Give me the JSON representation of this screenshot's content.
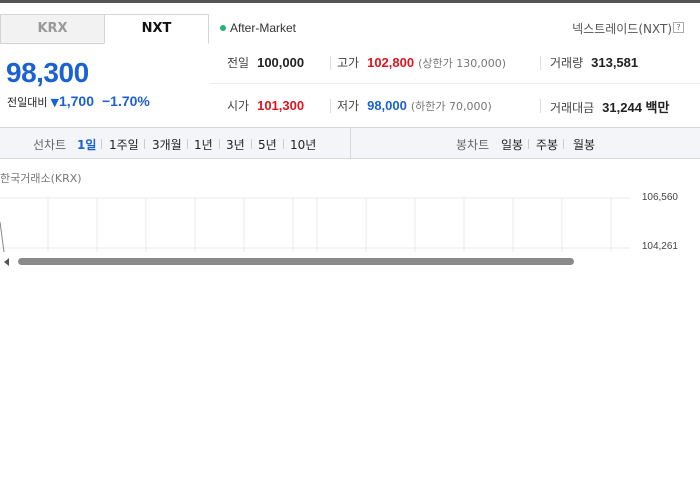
{
  "tabs": [
    {
      "label": "KRX",
      "active": false
    },
    {
      "label": "NXT",
      "active": true
    }
  ],
  "market_status": "After-Market",
  "exchange_name": "넥스트레이드(NXT)",
  "help_glyph": "?",
  "price": {
    "current": "98,300",
    "change_label": "전일대비",
    "change_direction": "down",
    "change_amount": "1,700",
    "change_percent": "−1.70%"
  },
  "stats": {
    "prev_close": {
      "label": "전일",
      "value": "100,000"
    },
    "high": {
      "label": "고가",
      "value": "102,800",
      "limit_label": "(상한가 130,000)"
    },
    "volume": {
      "label": "거래량",
      "value": "313,581"
    },
    "open": {
      "label": "시가",
      "value": "101,300"
    },
    "low": {
      "label": "저가",
      "value": "98,000",
      "limit_label": "(하한가 70,000)"
    },
    "trade_value": {
      "label": "거래대금",
      "value": "31,244 백만"
    }
  },
  "toolbar": {
    "line_chart_label": "선차트",
    "line_periods": [
      "1일",
      "1주일",
      "3개월",
      "1년",
      "3년",
      "5년",
      "10년"
    ],
    "active_period": "1일",
    "candle_chart_label": "봉차트",
    "candle_periods": [
      "일봉",
      "주봉",
      "월봉"
    ]
  },
  "chart": {
    "source_label": "한국거래소(KRX)",
    "y_ticks": [
      "106,560",
      "104,261"
    ]
  },
  "colors": {
    "up": "#e0141e",
    "down": "#1a61d4",
    "status_dot": "#22b573"
  }
}
